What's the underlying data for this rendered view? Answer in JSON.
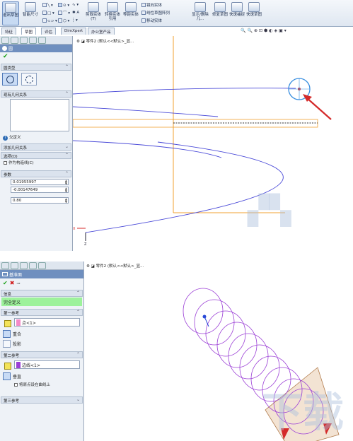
{
  "top": {
    "ribbon": {
      "sketch_btn": "退出草图",
      "smart_dim": "智能尺寸",
      "trim": "剪裁实体(T)",
      "convert": "转换实体引用",
      "offset": "等距实体",
      "mirror": "镜向实体",
      "linear_pattern": "线性草图阵列",
      "move": "移动实体",
      "display_delete": "显示/删除几...",
      "repair": "修复草图",
      "quick_snap": "快速捕捉",
      "rapid_sketch": "快速草图"
    },
    "tabs": [
      "特征",
      "草图",
      "评估",
      "DimXpert",
      "办公室产品"
    ],
    "tree": {
      "part": "零件2 (默认<<默认>_显..."
    },
    "pm": {
      "title": "圆",
      "section_circle_type": "圆类型",
      "section_relations": "现有几何关系",
      "under_defined": "欠定义",
      "section_add_relations": "添加几何关系",
      "section_options": "选项(O)",
      "construction": "作为构造线(C)",
      "section_params": "参数",
      "x": "0.01955997",
      "y": "-0.00147649",
      "r": "0.80"
    }
  },
  "bottom": {
    "tree": {
      "part": "零件2 (默认<<默认>_显..."
    },
    "pm": {
      "title": "基准面",
      "section_info": "信息",
      "status": "完全定义",
      "section_first_ref": "第一参考",
      "first_ref_value": "点<1>",
      "coincident": "重合",
      "project": "投影",
      "section_second_ref": "第二参考",
      "second_ref_value": "边线<1>",
      "perpendicular": "垂直",
      "origin_on_curve": "将原点设在曲线上",
      "section_third_ref": "第三参考"
    }
  },
  "colors": {
    "sketch_blue": "#4a4ad8",
    "orange_edge": "#f0a030",
    "arrow_red": "#d42a2a",
    "helix_purple": "#9b3fd6",
    "status_green": "#9df29b"
  }
}
